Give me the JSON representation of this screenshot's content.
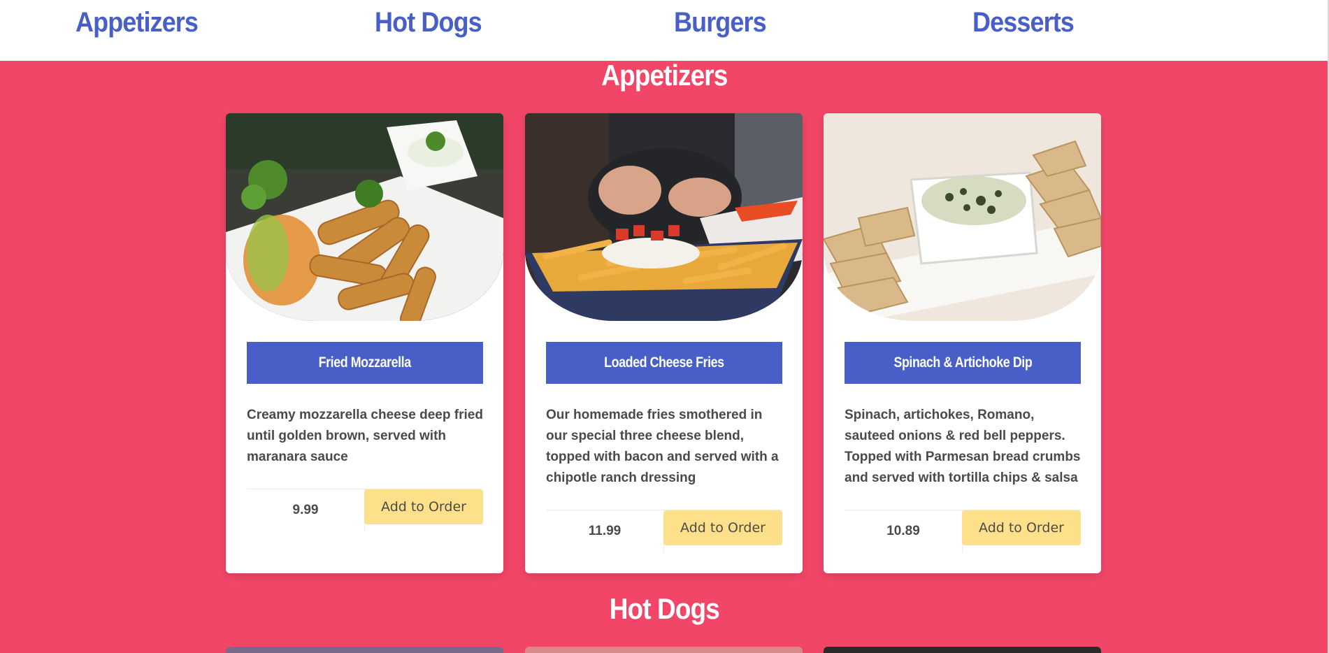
{
  "nav": {
    "items": [
      "Appetizers",
      "Hot Dogs",
      "Burgers",
      "Desserts"
    ]
  },
  "sections": [
    {
      "title": "Appetizers",
      "cards": [
        {
          "name": "Fried Mozzarella",
          "description": "Creamy mozzarella cheese deep fried until golden brown, served with maranara sauce",
          "price": "9.99",
          "button": "Add to Order"
        },
        {
          "name": "Loaded Cheese Fries",
          "description": "Our homemade fries smothered in our special three cheese blend, topped with bacon and served with a chipotle ranch dressing",
          "price": "11.99",
          "button": "Add to Order"
        },
        {
          "name": "Spinach & Artichoke Dip",
          "description": "Spinach, artichokes, Romano, sauteed onions & red bell peppers. Topped with Parmesan bread crumbs and served with tortilla chips & salsa",
          "price": "10.89",
          "button": "Add to Order"
        }
      ]
    },
    {
      "title": "Hot Dogs"
    }
  ],
  "colors": {
    "background": "#f14668",
    "nav_link": "#485fc7",
    "title_bar": "#485fc7",
    "button": "#ffe08a"
  }
}
